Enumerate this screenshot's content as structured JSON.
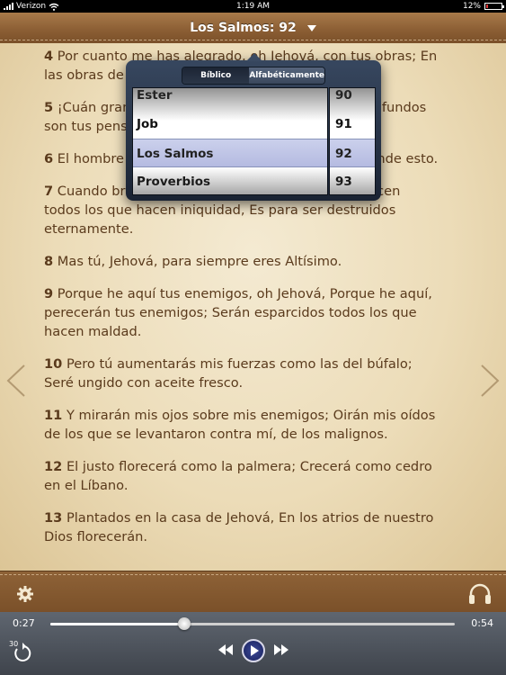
{
  "status_bar": {
    "carrier": "Verizon",
    "time": "1:19 AM",
    "battery": "12%",
    "battery_level": 0.12
  },
  "nav": {
    "title": "Los Salmos: 92"
  },
  "verses": [
    {
      "num": "4",
      "text": "Por cuanto me has alegrado, oh Jehová, con tus obras; En las obras de tus manos me gozo."
    },
    {
      "num": "5",
      "text": "¡Cuán grandes son tus obras, oh Jehová! Muy profundos son tus pensamientos."
    },
    {
      "num": "6",
      "text": "El hombre necio no sabe, Y el insensato no entiende esto."
    },
    {
      "num": "7",
      "text": "Cuando brotan los impíos como la hierba, Y florecen todos los que hacen iniquidad, Es para ser destruidos eternamente."
    },
    {
      "num": "8",
      "text": "Mas tú, Jehová, para siempre eres Altísimo."
    },
    {
      "num": "9",
      "text": "Porque he aquí tus enemigos, oh Jehová, Porque he aquí, perecerán tus enemigos; Serán esparcidos todos los que hacen maldad."
    },
    {
      "num": "10",
      "text": "Pero tú aumentarás mis fuerzas como las del búfalo; Seré ungido con aceite fresco."
    },
    {
      "num": "11",
      "text": "Y mirarán mis ojos sobre mis enemigos; Oirán mis oídos de los que se levantaron contra mí, de los malignos."
    },
    {
      "num": "12",
      "text": "El justo florecerá como la palmera; Crecerá como cedro en el Líbano."
    },
    {
      "num": "13",
      "text": "Plantados en la casa de Jehová, En los atrios de nuestro Dios florecerán."
    }
  ],
  "picker": {
    "segments": [
      "Bíblico",
      "Alfabéticamente"
    ],
    "books": [
      "Ester",
      "Job",
      "Los Salmos",
      "Proverbios"
    ],
    "chapters": [
      "90",
      "91",
      "92",
      "93"
    ],
    "selected_book": "Los Salmos",
    "selected_chapter": "92"
  },
  "player": {
    "elapsed": "0:27",
    "total": "0:54",
    "progress": 0.33,
    "skip_back_seconds": "30"
  },
  "icons": {
    "prev_page": "chevron-left-icon",
    "next_page": "chevron-right-icon",
    "settings": "gear-icon",
    "audio": "headphones-icon",
    "rewind": "rewind-icon",
    "play": "play-icon",
    "fast_forward": "fast-forward-icon",
    "replay": "replay-30-icon"
  },
  "colors": {
    "wood": "#8a5d33",
    "paper": "#f0e3c6",
    "verse_text": "#5a3a1c",
    "picker_selection": "#8c95cf"
  }
}
